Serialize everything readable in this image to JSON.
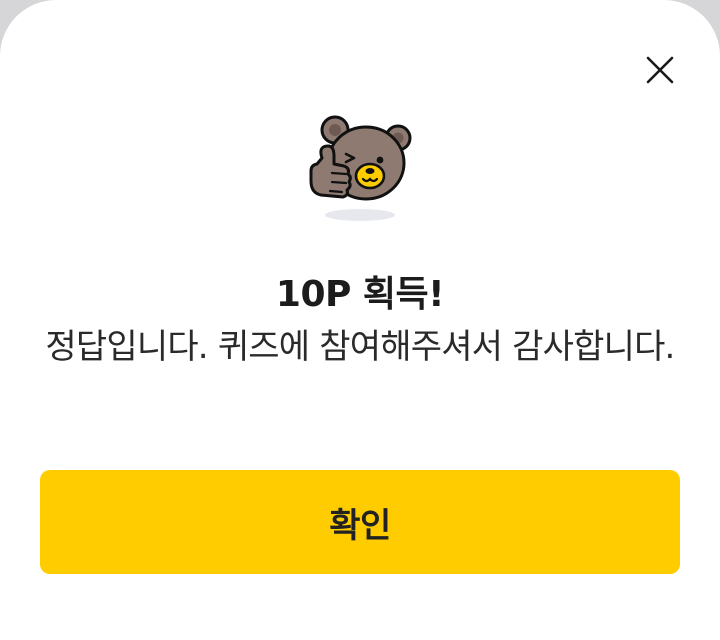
{
  "dialog": {
    "title": "10P 획득!",
    "message": "정답입니다. 퀴즈에 참여해주셔서 감사합니다.",
    "confirm_label": "확인",
    "close_icon": "close-icon",
    "mascot_icon": "bear-thumbs-up-icon"
  },
  "colors": {
    "accent": "#FFCC00",
    "background": "#FFFFFF",
    "backdrop": "#D6D6D9",
    "text": "#1C1C1C"
  }
}
